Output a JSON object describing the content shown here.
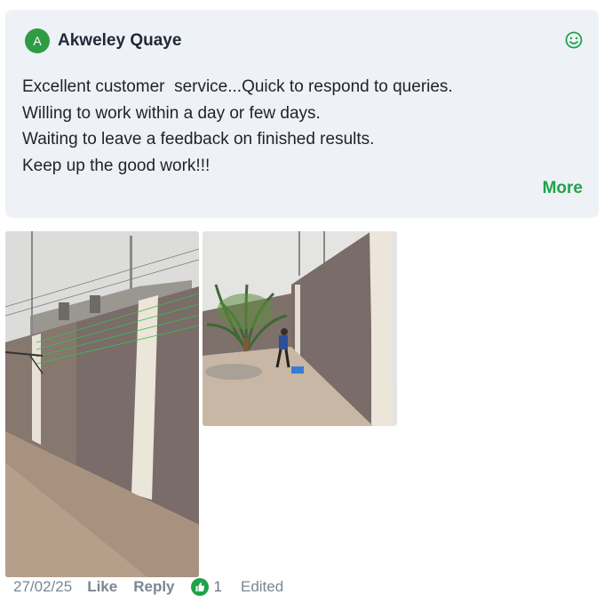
{
  "review": {
    "avatar_letter": "A",
    "author": "Akweley Quaye",
    "lines": [
      "Excellent customer  service...Quick to respond to queries.",
      "Willing to work within a day or few days.",
      "Waiting to leave a feedback on finished results.",
      "Keep up the good work!!!"
    ],
    "more_label": "More",
    "reaction_icon": "smiley-icon"
  },
  "photos": [
    {
      "name": "photo-wall-long-view",
      "icon": "photo"
    },
    {
      "name": "photo-wall-worker",
      "icon": "photo"
    }
  ],
  "footer": {
    "date": "27/02/25",
    "like_label": "Like",
    "reply_label": "Reply",
    "like_count": "1",
    "edited_label": "Edited"
  },
  "colors": {
    "card_bg": "#eef2f7",
    "accent_green": "#1fa34a",
    "avatar_bg": "#2e9b45",
    "muted": "#7a8794"
  }
}
